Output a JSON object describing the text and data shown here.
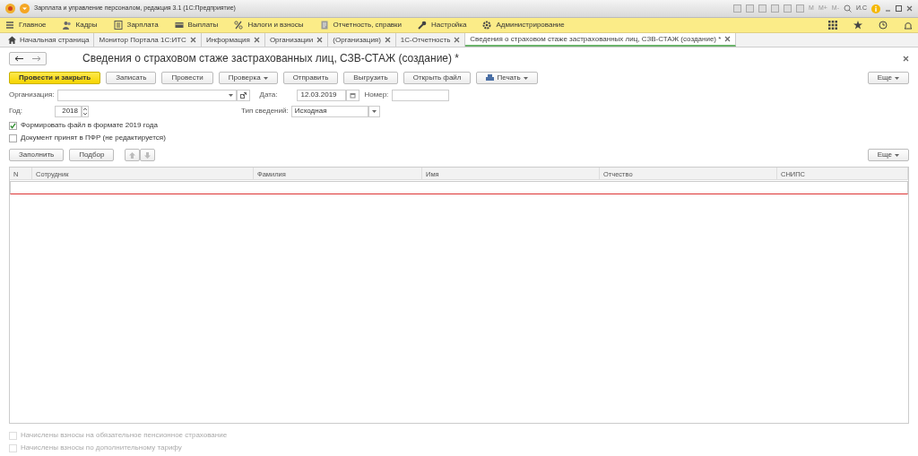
{
  "window": {
    "title": "Зарплата и управление персоналом, редакция 3.1  (1С:Предприятие)",
    "toolbar_texts": [
      "M",
      "M+",
      "M-"
    ],
    "user": "И.С"
  },
  "menu": [
    {
      "label": "Главное"
    },
    {
      "label": "Кадры"
    },
    {
      "label": "Зарплата"
    },
    {
      "label": "Выплаты"
    },
    {
      "label": "Налоги и взносы"
    },
    {
      "label": "Отчетность, справки"
    },
    {
      "label": "Настройка"
    },
    {
      "label": "Администрирование"
    }
  ],
  "tabs": [
    {
      "label": "Начальная страница",
      "selected": false,
      "kind": "home"
    },
    {
      "label": "Монитор Портала 1С:ИТС",
      "selected": false,
      "kind": "tab"
    },
    {
      "label": "Информация",
      "selected": false,
      "kind": "tab"
    },
    {
      "label": "Организации",
      "selected": false,
      "kind": "tab"
    },
    {
      "label": "(Организация)",
      "selected": false,
      "kind": "tab"
    },
    {
      "label": "1С-Отчетность",
      "selected": false,
      "kind": "tab"
    },
    {
      "label": "Сведения о страховом стаже застрахованных лиц, СЗВ-СТАЖ (создание) *",
      "selected": true,
      "kind": "tab"
    }
  ],
  "form": {
    "title": "Сведения о страховом стаже застрахованных лиц, СЗВ-СТАЖ (создание) *",
    "buttons": [
      {
        "label": "Провести и закрыть",
        "kind": "primary"
      },
      {
        "label": "Записать",
        "kind": "plain"
      },
      {
        "label": "Провести",
        "kind": "plain"
      },
      {
        "label": "Проверка",
        "kind": "dropdown"
      },
      {
        "label": "Отправить",
        "kind": "plain"
      },
      {
        "label": "Выгрузить",
        "kind": "plain"
      },
      {
        "label": "Открыть файл",
        "kind": "plain"
      },
      {
        "label": "Печать",
        "kind": "print"
      }
    ],
    "more": "Еще",
    "organization": {
      "label": "Организация:"
    },
    "date": {
      "label": "Дата:",
      "value": "12.03.2019"
    },
    "number": {
      "label": "Номер:"
    },
    "year": {
      "label": "Год:",
      "value": "2018"
    },
    "info_type": {
      "label": "Тип сведений:",
      "value": "Исходная"
    },
    "checkboxes": [
      {
        "label": "Формировать файл в формате 2019 года",
        "checked": true
      },
      {
        "label": "Документ принят в ПФР (не редактируется)",
        "checked": false
      }
    ],
    "table_buttons": [
      "Заполнить",
      "Подбор"
    ],
    "table_more": "Еще",
    "columns": [
      "N",
      "Сотрудник",
      "Фамилия",
      "Имя",
      "Отчество",
      "СНИПС"
    ],
    "bottom_checkboxes": [
      {
        "label": "Начислены взносы на обязательное пенсионное страхование",
        "checked": false,
        "disabled": true
      },
      {
        "label": "Начислены взносы по дополнительному тарифу",
        "checked": false,
        "disabled": true
      }
    ]
  }
}
